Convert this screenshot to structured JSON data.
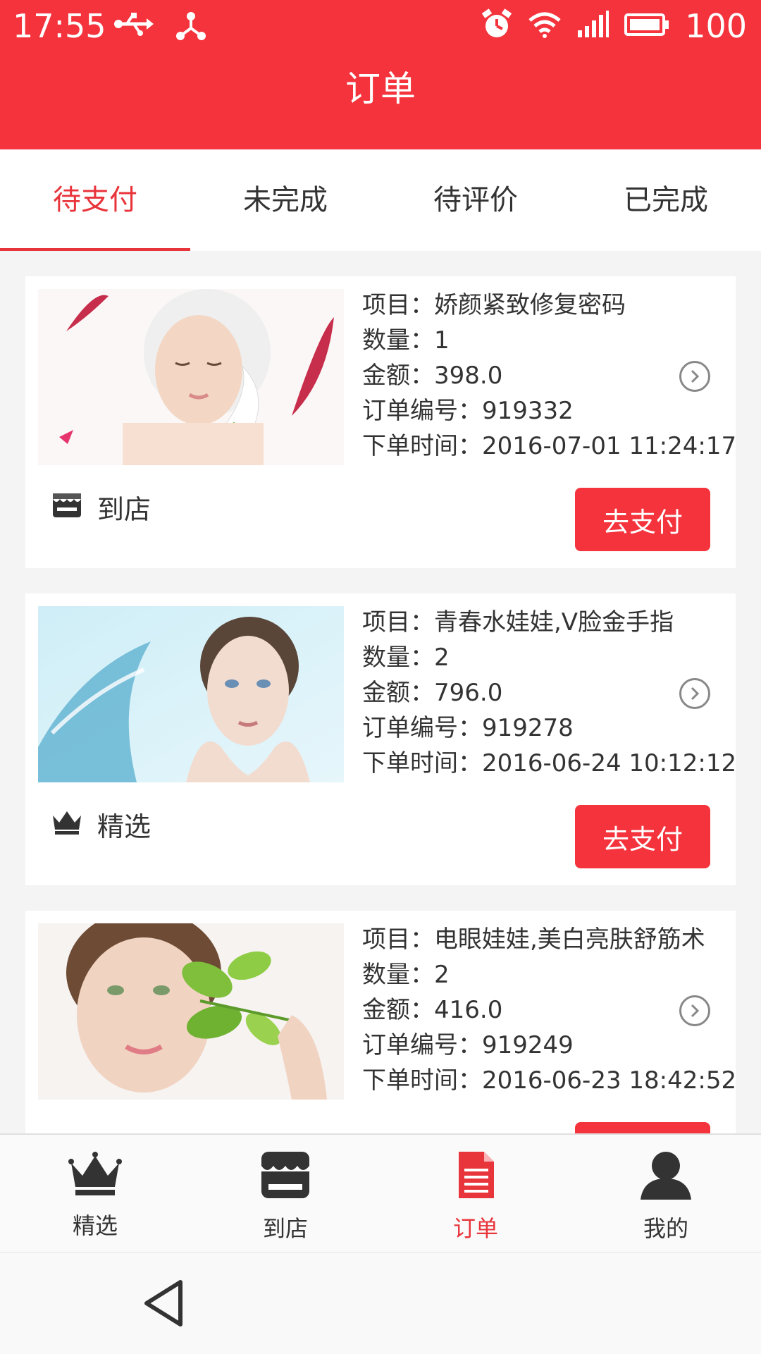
{
  "status_bar": {
    "time": "17:55",
    "battery": "100",
    "icons": [
      "usb-icon",
      "share-icon",
      "alarm-icon",
      "wifi-icon",
      "signal-icon",
      "battery-icon"
    ]
  },
  "header": {
    "title": "订单"
  },
  "tabs": [
    {
      "label": "待支付",
      "active": true
    },
    {
      "label": "未完成",
      "active": false
    },
    {
      "label": "待评价",
      "active": false
    },
    {
      "label": "已完成",
      "active": false
    }
  ],
  "orders": [
    {
      "project": "项目：娇颜紧致修复密码",
      "quantity": "数量：1",
      "amount": "金额：398.0",
      "order_no": "订单编号：919332",
      "time": "下单时间：2016-07-01 11:24:17",
      "source_icon": "store-icon",
      "source": "到店",
      "pay_label": "去支付"
    },
    {
      "project": "项目：青春水娃娃,V脸金手指",
      "quantity": "数量：2",
      "amount": "金额：796.0",
      "order_no": "订单编号：919278",
      "time": "下单时间：2016-06-24 10:12:12",
      "source_icon": "crown-icon",
      "source": "精选",
      "pay_label": "去支付"
    },
    {
      "project": "项目：电眼娃娃,美白亮肤舒筋术",
      "quantity": "数量：2",
      "amount": "金额：416.0",
      "order_no": "订单编号：919249",
      "time": "下单时间：2016-06-23 18:42:52",
      "pay_label": ""
    }
  ],
  "bottom_nav": [
    {
      "label": "精选",
      "icon": "crown-icon",
      "active": false
    },
    {
      "label": "到店",
      "icon": "store-icon",
      "active": false
    },
    {
      "label": "订单",
      "icon": "document-icon",
      "active": true
    },
    {
      "label": "我的",
      "icon": "user-icon",
      "active": false
    }
  ],
  "colors": {
    "brand": "#f4333c",
    "active_text": "#e8343b",
    "text": "#333333"
  }
}
